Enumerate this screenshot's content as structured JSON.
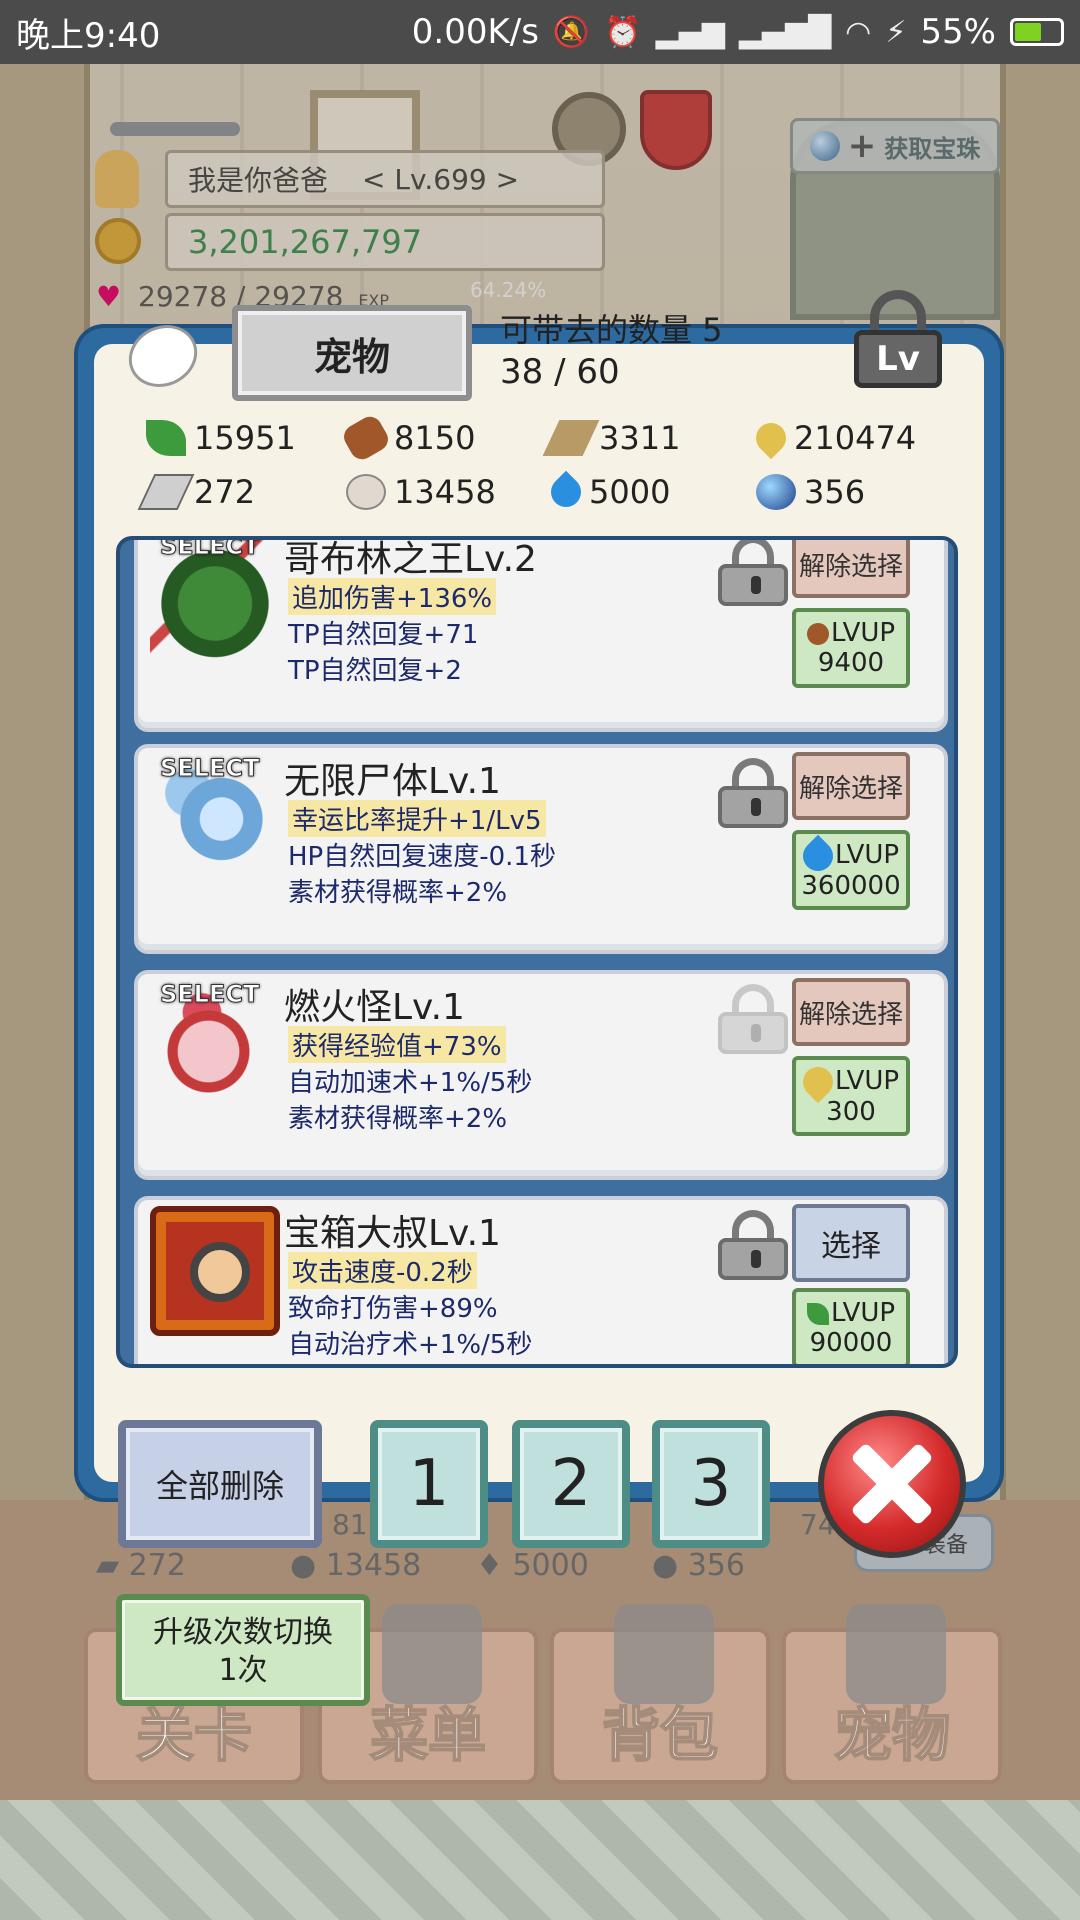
{
  "status_bar": {
    "time": "晚上9:40",
    "net_speed": "0.00K/s",
    "battery": "55%"
  },
  "hud": {
    "player_name": "我是你爸爸",
    "player_level": "< Lv.699 >",
    "gold": "3,201,267,797",
    "hp": "29278 / 29278",
    "exp_label": "EXP",
    "exp_percent": "64.24%",
    "get_orb_label": "获取宝珠"
  },
  "dialog": {
    "title": "宠物",
    "carry_label": "可带去的数量 5",
    "carry_value": "38 / 60",
    "lv_badge": "Lv"
  },
  "resources": [
    {
      "icon": "leaf-icon",
      "value": "15951"
    },
    {
      "icon": "wood-log-icon",
      "value": "8150"
    },
    {
      "icon": "plank-icon",
      "value": "3311"
    },
    {
      "icon": "droplet-icon",
      "value": "210474"
    },
    {
      "icon": "iron-ingot-icon",
      "value": "272"
    },
    {
      "icon": "stone-icon",
      "value": "13458"
    },
    {
      "icon": "flame-icon",
      "value": "5000"
    },
    {
      "icon": "orb-icon",
      "value": "356"
    }
  ],
  "pets": [
    {
      "select_tag": "SELECT",
      "name": "哥布林之王Lv.2",
      "stat1": "追加伤害+136%",
      "stat2": "TP自然回复+71",
      "stat3": "TP自然回复+2",
      "action_label": "解除选择",
      "lvup_label": "LVUP",
      "lvup_cost": "9400",
      "lvup_icon": "wood-log-icon"
    },
    {
      "select_tag": "SELECT",
      "name": "无限尸体Lv.1",
      "stat1": "幸运比率提升+1/Lv5",
      "stat2": "HP自然回复速度-0.1秒",
      "stat3": "素材获得概率+2%",
      "action_label": "解除选择",
      "lvup_label": "LVUP",
      "lvup_cost": "360000",
      "lvup_icon": "flame-icon"
    },
    {
      "select_tag": "SELECT",
      "name": "燃火怪Lv.1",
      "stat1": "获得经验值+73%",
      "stat2": "自动加速术+1%/5秒",
      "stat3": "素材获得概率+2%",
      "action_label": "解除选择",
      "lvup_label": "LVUP",
      "lvup_cost": "300",
      "lvup_icon": "droplet-icon"
    },
    {
      "select_tag": "",
      "name": "宝箱大叔Lv.1",
      "stat1": "攻击速度-0.2秒",
      "stat2": "致命打伤害+89%",
      "stat3": "自动治疗术+1%/5秒",
      "action_label": "选择",
      "lvup_label": "LVUP",
      "lvup_cost": "90000",
      "lvup_icon": "leaf-icon"
    }
  ],
  "bottom_buttons": {
    "delete_all": "全部删除",
    "slot1": "1",
    "slot2": "2",
    "slot3": "3"
  },
  "background_strip": {
    "res_iron": "272",
    "res_stone": "13458",
    "res_flame": "5000",
    "res_orb": "356",
    "partial_left": "81",
    "partial_right": "74",
    "equip_all": "全部装备"
  },
  "upgrade_toggle": {
    "line1": "升级次数切换",
    "line2": "1次"
  },
  "nav": [
    {
      "label": "关卡"
    },
    {
      "label": "菜单"
    },
    {
      "label": "背包"
    },
    {
      "label": "宠物"
    }
  ]
}
